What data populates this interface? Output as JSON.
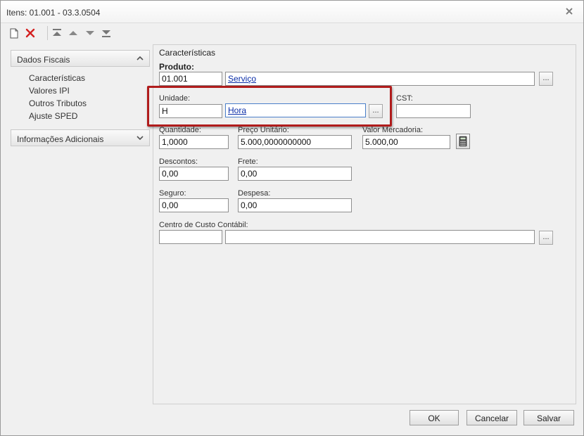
{
  "window": {
    "title": "Itens: 01.001 - 03.3.0504"
  },
  "toolbar": {
    "buttons": [
      {
        "name": "new-document-icon"
      },
      {
        "name": "delete-icon"
      },
      {
        "name": "first-record-icon"
      },
      {
        "name": "previous-record-icon"
      },
      {
        "name": "next-record-icon"
      },
      {
        "name": "last-record-icon"
      }
    ]
  },
  "sidebar": {
    "sections": [
      {
        "label": "Dados Fiscais",
        "expanded": true,
        "items": [
          "Características",
          "Valores IPI",
          "Outros Tributos",
          "Ajuste SPED"
        ]
      },
      {
        "label": "Informações Adicionais",
        "expanded": false,
        "items": []
      }
    ]
  },
  "form": {
    "section_title": "Características",
    "produto": {
      "label": "Produto:",
      "code": "01.001",
      "description": "Serviço"
    },
    "unidade": {
      "label": "Unidade:",
      "code": "H",
      "description": "Hora"
    },
    "cst": {
      "label": "CST:",
      "value": ""
    },
    "quantidade": {
      "label": "Quantidade:",
      "value": "1,0000"
    },
    "preco_unitario": {
      "label": "Preço Unitário:",
      "value": "5.000,0000000000"
    },
    "valor_mercadoria": {
      "label": "Valor Mercadoria:",
      "value": "5.000,00"
    },
    "descontos": {
      "label": "Descontos:",
      "value": "0,00"
    },
    "frete": {
      "label": "Frete:",
      "value": "0,00"
    },
    "seguro": {
      "label": "Seguro:",
      "value": "0,00"
    },
    "despesa": {
      "label": "Despesa:",
      "value": "0,00"
    },
    "centro_custo": {
      "label": "Centro de Custo Contábil:",
      "code": "",
      "description": ""
    },
    "ellipsis": "..."
  },
  "footer": {
    "ok": "OK",
    "cancel": "Cancelar",
    "save": "Salvar"
  },
  "colors": {
    "highlight": "#b01c1c",
    "link": "#0b2ea8",
    "delete_icon": "#d42020"
  }
}
